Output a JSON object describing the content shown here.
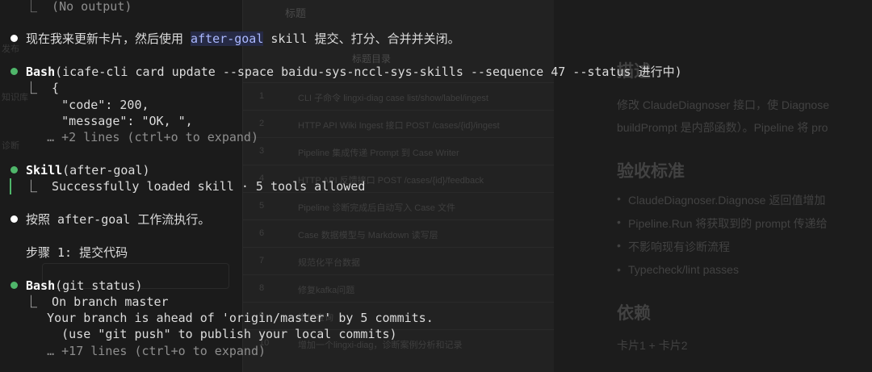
{
  "terminal": {
    "prev_output": "⎿  (No output)",
    "msg1_pre": "现在我来更新卡片，然后使用 ",
    "msg1_skill": "after-goal",
    "msg1_post": " skill 提交、打分、合并并关闭。",
    "bash1_tool": "Bash",
    "bash1_args": "(icafe-cli card update --space baidu-sys-nccl-sys-skills --sequence 47 --status 进行中)",
    "bash1_out1": "⎿  {",
    "bash1_out2": "     \"code\": 200,",
    "bash1_out3": "     \"message\": \"OK, \",",
    "bash1_more": "   … +2 lines (ctrl+o to expand)",
    "skill_tool": "Skill",
    "skill_args": "(after-goal)",
    "skill_out": "⎿  Successfully loaded skill · 5 tools allowed",
    "msg2": "按照 after-goal 工作流执行。",
    "step1": "步骤 1: 提交代码",
    "bash2_tool": "Bash",
    "bash2_args": "(git status)",
    "bash2_out1": "⎿  On branch master",
    "bash2_out2": "   Your branch is ahead of 'origin/master' by 5 commits.",
    "bash2_out3": "     (use \"git push\" to publish your local commits)",
    "bash2_more": "   … +17 lines (ctrl+o to expand)"
  },
  "background": {
    "mid_header": "标题",
    "mid_subheader": "标题目录",
    "rows": [
      {
        "n": "1",
        "t": "CLI 子命令 lingxi-diag case list/show/label/ingest"
      },
      {
        "n": "2",
        "t": "HTTP API Wiki Ingest 接口 POST /cases/{id}/ingest"
      },
      {
        "n": "3",
        "t": "Pipeline 集成传递 Prompt 到 Case Writer"
      },
      {
        "n": "4",
        "t": "HTTP API 反馈接口 POST /cases/{id}/feedback"
      },
      {
        "n": "5",
        "t": "Pipeline 诊断完成后自动写入 Case 文件"
      },
      {
        "n": "6",
        "t": "Case 数据模型与 Markdown 读写层"
      },
      {
        "n": "7",
        "t": "规范化平台数据"
      },
      {
        "n": "8",
        "t": "修复kafka问题"
      },
      {
        "n": "9",
        "t": "增加查询"
      },
      {
        "n": "10",
        "t": "增加一个lingxi-diag，诊断案例分析和记录"
      }
    ],
    "side1": "发布",
    "side2": "知识库",
    "side3": "诊断",
    "right_title": "描述",
    "right_p1": "修改 ClaudeDiagnoser 接口，使 Diagnose",
    "right_p2": "buildPrompt 是内部函数）。Pipeline 将 pro",
    "right_h2": "验收标准",
    "right_li1": "ClaudeDiagnoser.Diagnose 返回值增加",
    "right_li2": "Pipeline.Run 将获取到的 prompt 传递给",
    "right_li3": "不影响现有诊断流程",
    "right_li4": "Typecheck/lint passes",
    "right_h3": "依赖",
    "right_dep": "卡片1 + 卡片2"
  },
  "colors": {
    "bullet_done": "#4fb66a",
    "bullet_message": "#ffffff",
    "skill_highlight": "#aab8ff"
  }
}
